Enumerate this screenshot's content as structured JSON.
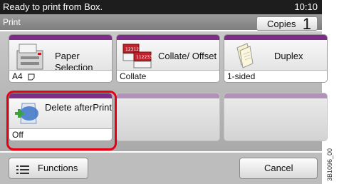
{
  "status": {
    "message": "Ready to print from Box.",
    "time": "10:10"
  },
  "title": "Print",
  "copies": {
    "label": "Copies",
    "value": "1"
  },
  "tiles": [
    {
      "label": "Paper Selection",
      "value": "A4",
      "icon": "printer-paper-tray-icon"
    },
    {
      "label": "Collate/ Offset",
      "value": "Collate",
      "icon": "collated-stacks-icon"
    },
    {
      "label": "Duplex",
      "value": "1-sided",
      "icon": "duplex-pages-icon"
    },
    {
      "label": "Delete afterPrint",
      "value": "Off",
      "icon": "delete-after-print-icon",
      "selected": true
    }
  ],
  "footer": {
    "functions_label": "Functions",
    "cancel_label": "Cancel"
  },
  "side_code": "3B1096_00",
  "colors": {
    "accent_stripe": "#7d2d88",
    "selection_ring": "#e60012",
    "status_bar": "#1d1d1d"
  }
}
